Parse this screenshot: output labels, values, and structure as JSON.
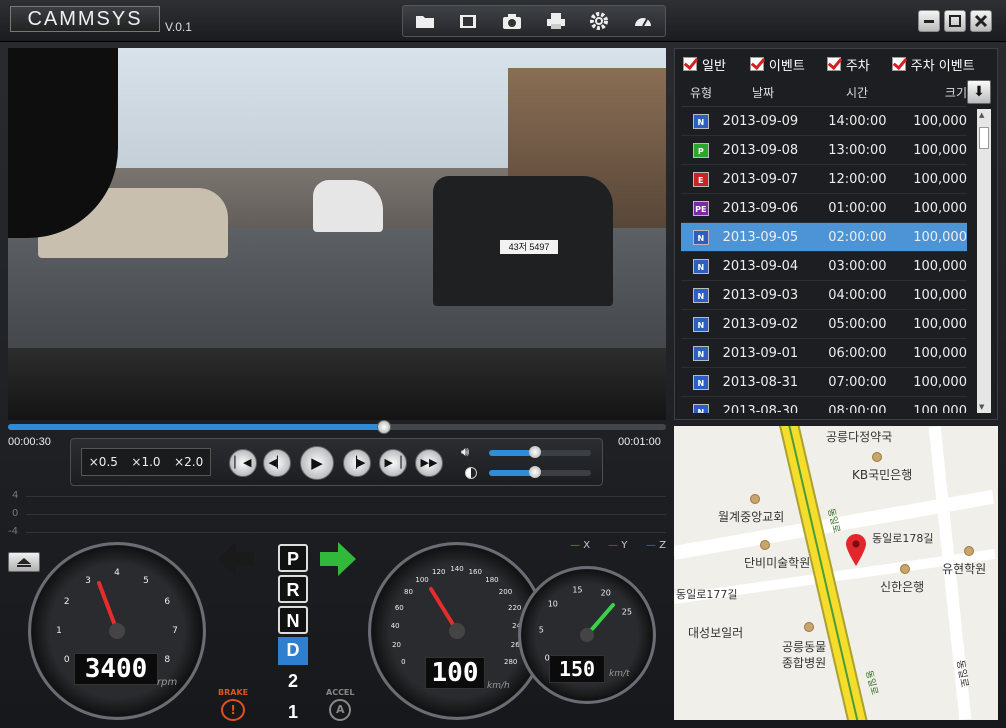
{
  "app": {
    "title": "CAMMSYS",
    "version": "V.0.1"
  },
  "toolbar": {
    "icons": [
      "folder-icon",
      "film-icon",
      "camera-icon",
      "printer-icon",
      "gear-icon",
      "speedometer-icon"
    ]
  },
  "window": {
    "minimize": "minimize-icon",
    "maximize": "maximize-icon",
    "close": "close-icon"
  },
  "video": {
    "plate": "43저 5497"
  },
  "playback": {
    "current_time": "00:00:30",
    "total_time": "00:01:00",
    "progress": 0.5,
    "volume": 0.45,
    "brightness": 0.45
  },
  "speed_options": [
    "×0.5",
    "×1.0",
    "×2.0"
  ],
  "graph": {
    "y_labels": [
      "4",
      "0",
      "-4"
    ],
    "legend": [
      {
        "label": "X",
        "color": "#3aa83a"
      },
      {
        "label": "Y",
        "color": "#d63a2c"
      },
      {
        "label": "Z",
        "color": "#3a6fd6"
      }
    ]
  },
  "dashboard": {
    "rpm_value": "3400",
    "rpm_unit": "rpm",
    "speed_value": "100",
    "speed_unit": "km/h",
    "speed2_value": "150",
    "speed2_unit": "km/t",
    "gears": [
      "P",
      "R",
      "N",
      "D",
      "2",
      "1"
    ],
    "active_gear": "D",
    "brake_label": "BRAKE",
    "accel_label": "ACCEL",
    "rpm_ticks": [
      "0",
      "1",
      "2",
      "3",
      "4",
      "5",
      "6",
      "7",
      "8"
    ],
    "speed_ticks": [
      "0",
      "20",
      "40",
      "60",
      "80",
      "100",
      "120",
      "140",
      "160",
      "180",
      "200",
      "220",
      "240",
      "260",
      "280"
    ],
    "speed2_ticks": [
      "0",
      "5",
      "10",
      "15",
      "20",
      "25"
    ]
  },
  "list": {
    "filters": [
      "일반",
      "이벤트",
      "주차",
      "주차 이벤트"
    ],
    "headers": {
      "type": "유형",
      "date": "날짜",
      "time": "시간",
      "size": "크기"
    },
    "rows": [
      {
        "type": "N",
        "color": "#2d5fc0",
        "date": "2013-09-09",
        "time": "14:00:00",
        "size": "100,000"
      },
      {
        "type": "P",
        "color": "#2aa62a",
        "date": "2013-09-08",
        "time": "13:00:00",
        "size": "100,000"
      },
      {
        "type": "E",
        "color": "#c92424",
        "date": "2013-09-07",
        "time": "12:00:00",
        "size": "100,000"
      },
      {
        "type": "PE",
        "color": "#7a2aa6",
        "date": "2013-09-06",
        "time": "01:00:00",
        "size": "100,000"
      },
      {
        "type": "N",
        "color": "#2d5fc0",
        "date": "2013-09-05",
        "time": "02:00:00",
        "size": "100,000",
        "selected": true
      },
      {
        "type": "N",
        "color": "#2d5fc0",
        "date": "2013-09-04",
        "time": "03:00:00",
        "size": "100,000"
      },
      {
        "type": "N",
        "color": "#2d5fc0",
        "date": "2013-09-03",
        "time": "04:00:00",
        "size": "100,000"
      },
      {
        "type": "N",
        "color": "#2d5fc0",
        "date": "2013-09-02",
        "time": "05:00:00",
        "size": "100,000"
      },
      {
        "type": "N",
        "color": "#2d5fc0",
        "date": "2013-09-01",
        "time": "06:00:00",
        "size": "100,000"
      },
      {
        "type": "N",
        "color": "#2d5fc0",
        "date": "2013-08-31",
        "time": "07:00:00",
        "size": "100,000"
      },
      {
        "type": "N",
        "color": "#2d5fc0",
        "date": "2013-08-30",
        "time": "08:00:00",
        "size": "100,000"
      }
    ]
  },
  "map": {
    "labels": [
      "공릉다정약국",
      "KB국민은행",
      "월계중앙교회",
      "단비미술학원",
      "동일로178길",
      "유현학원",
      "신한은행",
      "동일로177길",
      "대성보일러",
      "공릉동물",
      "종합병원",
      "동일로",
      "동일로",
      "동일로"
    ]
  },
  "colors": {
    "accent": "#2f8cd8",
    "selected_row": "#4c94d6",
    "brake": "#e0531e",
    "arrow_green": "#32b83a"
  }
}
